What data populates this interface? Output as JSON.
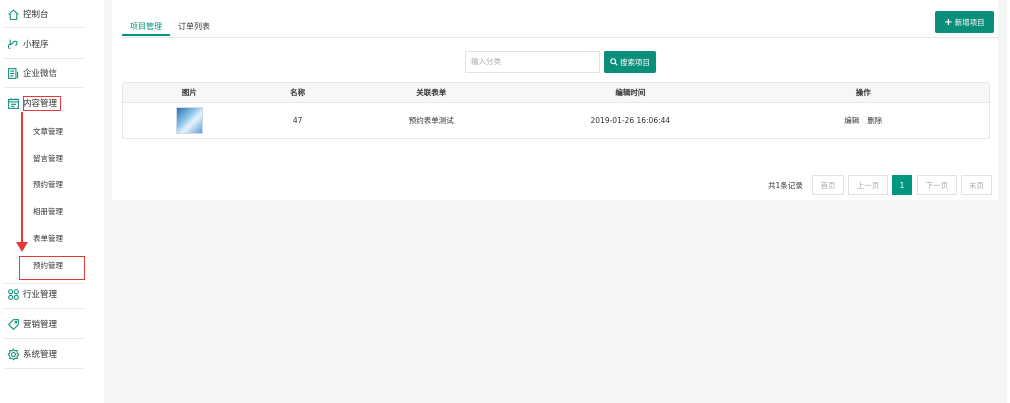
{
  "sidebar": {
    "items": [
      {
        "label": "控制台",
        "icon": "home-icon"
      },
      {
        "label": "小程序",
        "icon": "miniprogram-icon"
      },
      {
        "label": "企业微信",
        "icon": "document-icon"
      },
      {
        "label": "内容管理",
        "icon": "calendar-icon"
      },
      {
        "label": "行业管理",
        "icon": "grid-icon"
      },
      {
        "label": "营销管理",
        "icon": "tag-icon"
      },
      {
        "label": "系统管理",
        "icon": "gear-icon"
      }
    ],
    "sub_items": [
      {
        "label": "文章管理"
      },
      {
        "label": "留言管理"
      },
      {
        "label": "预约管理"
      },
      {
        "label": "相册管理"
      },
      {
        "label": "表单管理"
      },
      {
        "label": "预约管理"
      }
    ],
    "annotation_color": "#e53935"
  },
  "tabs": [
    {
      "label": "项目管理",
      "active": true
    },
    {
      "label": "订单列表",
      "active": false
    }
  ],
  "add_button": {
    "label": "新增项目",
    "icon": "plus-icon"
  },
  "search": {
    "placeholder": "输入分类",
    "button_label": "搜索项目",
    "button_icon": "search-icon"
  },
  "table": {
    "headers": [
      "图片",
      "名称",
      "关联表单",
      "编辑时间",
      "操作"
    ],
    "rows": [
      {
        "image": "thumbnail",
        "name": "47",
        "form": "预约表单测试",
        "edit_time": "2019-01-26 16:06:44",
        "actions": [
          "编辑",
          "删除"
        ]
      }
    ]
  },
  "pagination": {
    "total": "共1条记录",
    "first": "首页",
    "prev": "上一页",
    "current": "1",
    "next": "下一页",
    "last": "末页"
  },
  "colors": {
    "accent": "#00967f",
    "annotation": "#e53935"
  }
}
